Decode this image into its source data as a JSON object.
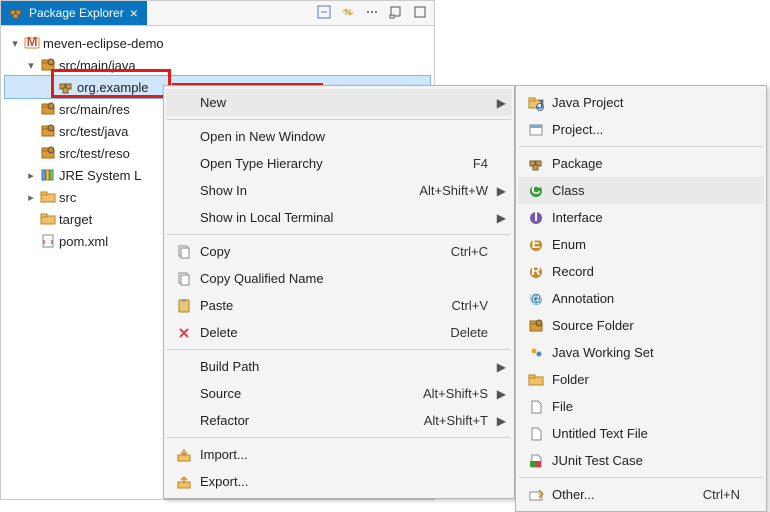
{
  "tab": {
    "title": "Package Explorer"
  },
  "tree": {
    "project": "meven-eclipse-demo",
    "srcMainJava": "src/main/java",
    "pkg": "org.example",
    "srcMainRes": "src/main/res",
    "srcTestJava": "src/test/java",
    "srcTestRes": "src/test/reso",
    "jre": "JRE System L",
    "src": "src",
    "target": "target",
    "pom": "pom.xml"
  },
  "ctx": {
    "new": "New",
    "openWin": "Open in New Window",
    "openType": "Open Type Hierarchy",
    "openTypeKey": "F4",
    "showIn": "Show In",
    "showInKey": "Alt+Shift+W",
    "showLocal": "Show in Local Terminal",
    "copy": "Copy",
    "copyKey": "Ctrl+C",
    "copyQual": "Copy Qualified Name",
    "paste": "Paste",
    "pasteKey": "Ctrl+V",
    "delete": "Delete",
    "deleteKey": "Delete",
    "buildPath": "Build Path",
    "source": "Source",
    "sourceKey": "Alt+Shift+S",
    "refactor": "Refactor",
    "refactorKey": "Alt+Shift+T",
    "import": "Import...",
    "export": "Export..."
  },
  "new": {
    "javaProject": "Java Project",
    "project": "Project...",
    "package": "Package",
    "class": "Class",
    "interface": "Interface",
    "enum": "Enum",
    "record": "Record",
    "annotation": "Annotation",
    "sourceFolder": "Source Folder",
    "workingSet": "Java Working Set",
    "folder": "Folder",
    "file": "File",
    "untitled": "Untitled Text File",
    "junit": "JUnit Test Case",
    "other": "Other...",
    "otherKey": "Ctrl+N"
  }
}
